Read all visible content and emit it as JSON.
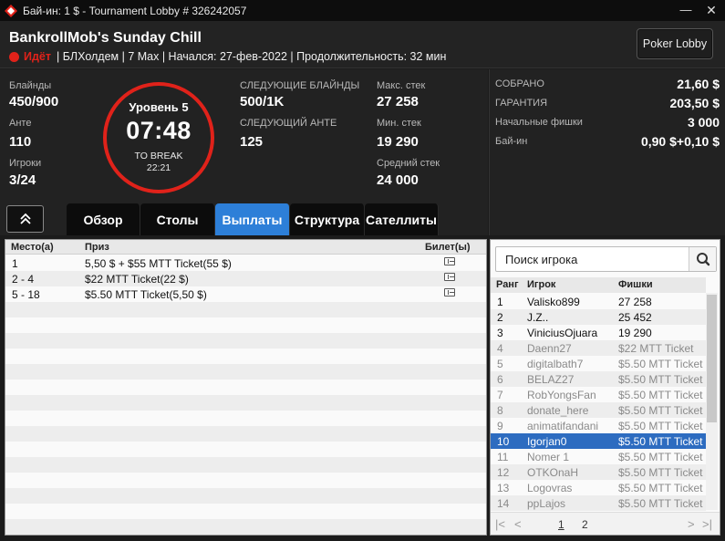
{
  "window": {
    "title": "Бай-ин: 1 $ - Tournament Lobby # 326242057",
    "minimize_symbol": "—",
    "close_symbol": "✕"
  },
  "header": {
    "name": "BankrollMob's Sunday Chill",
    "status": "Идёт",
    "info": "| БЛХолдем | 7 Max | Начался: 27-фев-2022 | Продолжительность: 32 мин",
    "lobby_button": "Poker Lobby"
  },
  "stats": {
    "blinds_label": "Блайнды",
    "blinds_value": "450/900",
    "ante_label": "Анте",
    "ante_value": "110",
    "players_label": "Игроки",
    "players_value": "3/24",
    "next_blinds_label": "СЛЕДУЮЩИЕ БЛАЙНДЫ",
    "next_blinds_value": "500/1K",
    "next_ante_label": "СЛЕДУЮЩИЙ АНТЕ",
    "next_ante_value": "125",
    "max_stack_label": "Макс. стек",
    "max_stack_value": "27 258",
    "min_stack_label": "Мин. стек",
    "min_stack_value": "19 290",
    "avg_stack_label": "Средний стек",
    "avg_stack_value": "24 000"
  },
  "clock": {
    "level": "Уровень 5",
    "time": "07:48",
    "break_label": "TO BREAK",
    "break_time": "22:21"
  },
  "prize": {
    "collected_label": "СОБРАНО",
    "collected_value": "21,60 $",
    "guarantee_label": "ГАРАНТИЯ",
    "guarantee_value": "203,50 $",
    "chips_label": "Начальные фишки",
    "chips_value": "3 000",
    "buyin_label": "Бай-ин",
    "buyin_value": "0,90 $+0,10 $"
  },
  "tabs": [
    "Обзор",
    "Столы",
    "Выплаты",
    "Структура",
    "Сателлиты"
  ],
  "active_tab": "Выплаты",
  "payouts": {
    "headers": {
      "place": "Место(а)",
      "prize": "Приз",
      "ticket": "Билет(ы)"
    },
    "rows": [
      {
        "place": "1",
        "prize": "5,50 $ + $55 MTT Ticket(55 $)"
      },
      {
        "place": "2 - 4",
        "prize": "$22 MTT Ticket(22 $)"
      },
      {
        "place": "5 - 18",
        "prize": "$5.50 MTT Ticket(5,50 $)"
      }
    ]
  },
  "players": {
    "search_placeholder": "Поиск игрока",
    "headers": {
      "rank": "Ранг",
      "player": "Игрок",
      "chips": "Фишки"
    },
    "rows": [
      {
        "rank": "1",
        "name": "Valisko899",
        "chips": "27 258"
      },
      {
        "rank": "2",
        "name": "J.Z..",
        "chips": "25 452"
      },
      {
        "rank": "3",
        "name": "ViniciusOjuara",
        "chips": "19 290"
      },
      {
        "rank": "4",
        "name": "Daenn27",
        "chips": "$22 MTT Ticket"
      },
      {
        "rank": "5",
        "name": "digitalbath7",
        "chips": "$5.50 MTT Ticket"
      },
      {
        "rank": "6",
        "name": "BELAZ27",
        "chips": "$5.50 MTT Ticket"
      },
      {
        "rank": "7",
        "name": "RobYongsFan",
        "chips": "$5.50 MTT Ticket"
      },
      {
        "rank": "8",
        "name": "donate_here",
        "chips": "$5.50 MTT Ticket"
      },
      {
        "rank": "9",
        "name": "animatifandani",
        "chips": "$5.50 MTT Ticket"
      },
      {
        "rank": "10",
        "name": "Igorjan0",
        "chips": "$5.50 MTT Ticket"
      },
      {
        "rank": "11",
        "name": "Nomer 1",
        "chips": "$5.50 MTT Ticket"
      },
      {
        "rank": "12",
        "name": "OTKOnaH",
        "chips": "$5.50 MTT Ticket"
      },
      {
        "rank": "13",
        "name": "Logovras",
        "chips": "$5.50 MTT Ticket"
      },
      {
        "rank": "14",
        "name": "ppLajos",
        "chips": "$5.50 MTT Ticket"
      }
    ],
    "selected_rank": "10",
    "pages": [
      "1",
      "2"
    ],
    "current_page": "1"
  }
}
